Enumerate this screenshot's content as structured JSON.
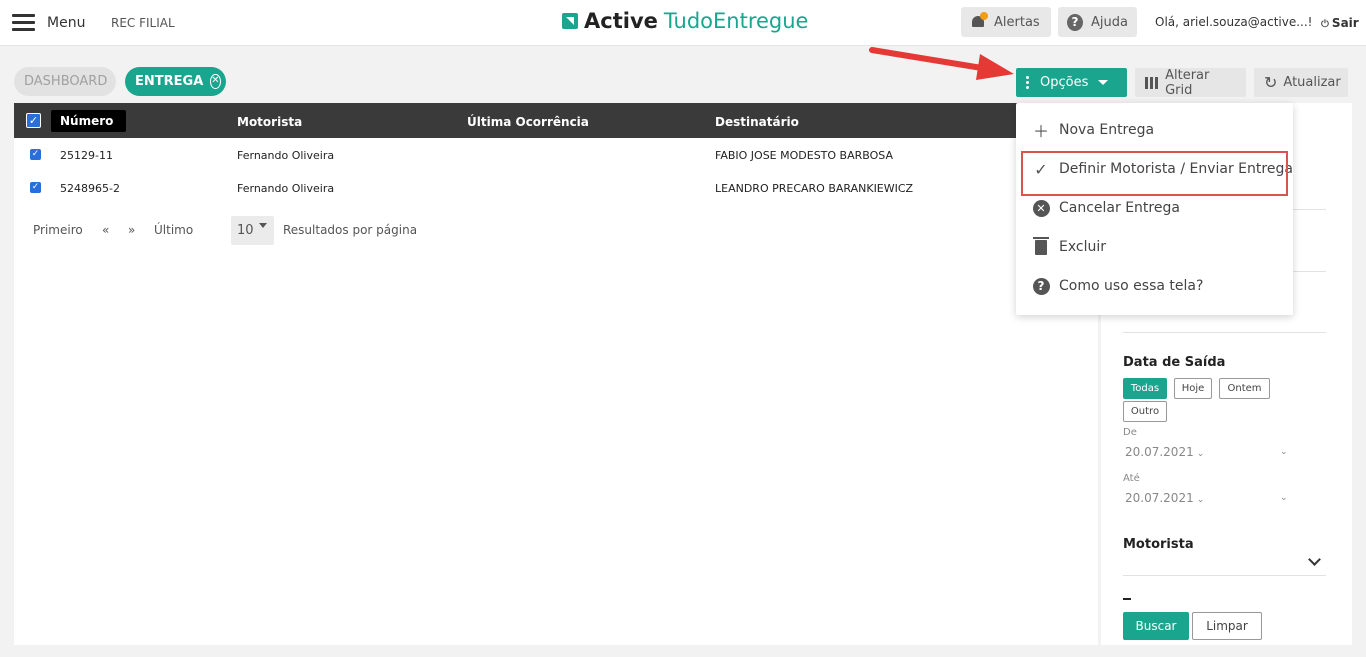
{
  "header": {
    "menu_label": "Menu",
    "filial": "REC FILIAL",
    "brand_active": "Active",
    "brand_tudo": "TudoEntregue",
    "alertas_label": "Alertas",
    "ajuda_label": "Ajuda",
    "greeting": "Olá, ariel.souza@active...!",
    "sair_label": "Sair"
  },
  "tabs": {
    "dashboard": "DASHBOARD",
    "entrega": "ENTREGA"
  },
  "toolbar": {
    "opcoes_label": "Opções",
    "alterar_grid_label": "Alterar Grid",
    "atualizar_label": "Atualizar"
  },
  "dropdown": {
    "items": [
      {
        "label": "Nova Entrega",
        "icon": "plus-icon"
      },
      {
        "label": "Definir Motorista / Enviar Entrega",
        "icon": "check-icon"
      },
      {
        "label": "Cancelar Entrega",
        "icon": "circle-x-icon"
      },
      {
        "label": "Excluir",
        "icon": "trash-icon"
      },
      {
        "label": "Como uso essa tela?",
        "icon": "question-icon"
      }
    ],
    "highlight_color": "#d9534f"
  },
  "grid": {
    "columns": [
      "Número",
      "Motorista",
      "Última Ocorrência",
      "Destinatário"
    ],
    "rows": [
      {
        "numero": "25129-11",
        "motorista": "Fernando Oliveira",
        "ultima": "",
        "destinatario": "FABIO JOSE MODESTO BARBOSA"
      },
      {
        "numero": "5248965-2",
        "motorista": "Fernando Oliveira",
        "ultima": "",
        "destinatario": "LEANDRO PRECARO BARANKIEWICZ"
      }
    ]
  },
  "pager": {
    "primeiro": "Primeiro",
    "prev": "«",
    "next": "»",
    "ultimo": "Último",
    "page_size": "10",
    "resultados": "Resultados por página"
  },
  "filters": {
    "data_saida_title": "Data de Saída",
    "pills": [
      "Todas",
      "Hoje",
      "Ontem",
      "Outro"
    ],
    "de_label": "De",
    "de_value": "20.07.2021",
    "ate_label": "Até",
    "ate_value": "20.07.2021",
    "motorista_title": "Motorista",
    "buscar_label": "Buscar",
    "limpar_label": "Limpar"
  },
  "colors": {
    "accent": "#1aa68e",
    "header_dark": "#3a3a3a",
    "annotation_arrow": "#e53935"
  }
}
